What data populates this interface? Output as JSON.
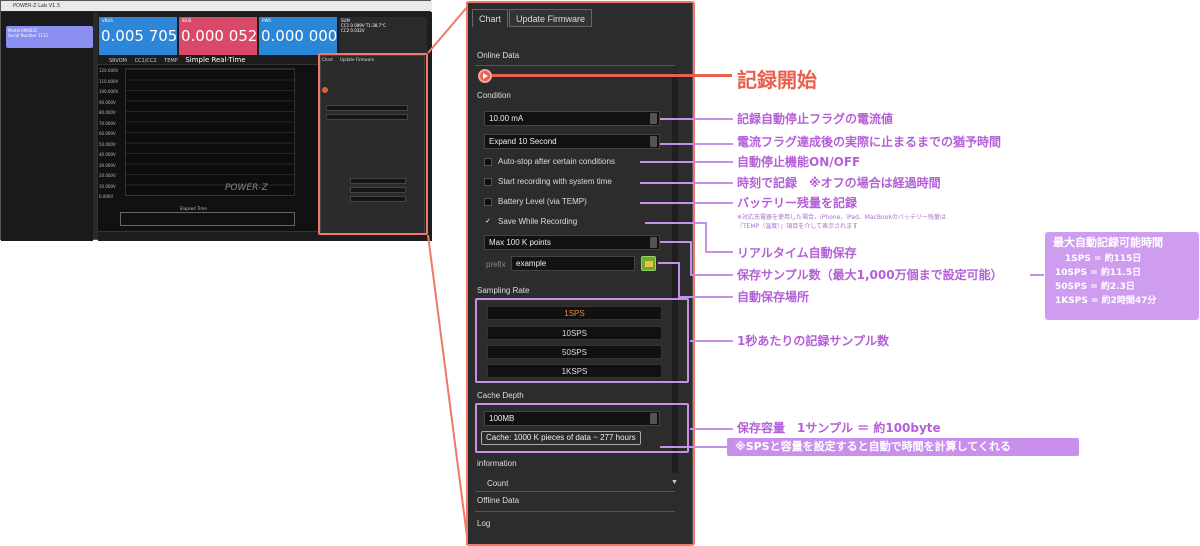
{
  "app": {
    "title": "POWER-Z Lab V1.5",
    "device": {
      "model_label": "Model",
      "model_value": "KM003C",
      "sn_label": "Serial Number",
      "sn_value": "1111"
    },
    "meters": {
      "vbus_label": "VBUS",
      "vbus_value": "0.005 705 V",
      "ibus_label": "IBUS",
      "ibus_value": "0.000 052 A",
      "pwr_label": "PWR",
      "pwr_value": "0.000 000W",
      "sum_line1": "SUM",
      "sum_line2": "CC1 0.099V  T1:38.7°C",
      "sum_line3": "CC2 0.032V"
    },
    "chart_title": "Simple Real-Time",
    "chart_tabs": [
      "SRVOM",
      "CC1/CC2",
      "TEMP"
    ],
    "y_ticks": [
      "120.000V",
      "110.000V",
      "100.000V",
      "90.000V",
      "80.000V",
      "70.000V",
      "60.000V",
      "50.000V",
      "40.000V",
      "30.000V",
      "20.000V",
      "10.000V",
      "0.000V"
    ],
    "x_label": "Elapsed Time",
    "brand": "POWER-Z"
  },
  "panel": {
    "tabs": [
      "Chart",
      "Update Firmware"
    ],
    "online_data": "Online Data",
    "condition_heading": "Condition",
    "current_value": "10.00 mA",
    "expand_value": "Expand 10 Second",
    "checks": [
      {
        "label": "Auto-stop after certain conditions",
        "checked": false
      },
      {
        "label": "Start recording with system time",
        "checked": false
      },
      {
        "label": "Battery Level (via TEMP)",
        "checked": false
      },
      {
        "label": "Save While Recording",
        "checked": true
      }
    ],
    "check_mark": "✓",
    "max_points": "Max 100 K points",
    "prefix_label": "prefix",
    "prefix_value": "example",
    "sampling_heading": "Sampling Rate",
    "rates": [
      "1SPS",
      "10SPS",
      "50SPS",
      "1KSPS"
    ],
    "cache_heading": "Cache Depth",
    "cache_value": "100MB",
    "cache_info": "Cache: 1000 K pieces of data ~ 277 hours",
    "information": "information",
    "count": "Count",
    "offline_data": "Offline Data",
    "log": "Log"
  },
  "annotations": {
    "start": "記録開始",
    "current_flag": "記録自動停止フラグの電流値",
    "grace": "電流フラグ達成後の実際に止まるまでの猶予時間",
    "autostop": "自動停止機能ON/OFF",
    "systime": "時刻で記録　※オフの場合は経過時間",
    "battery": "バッテリー残量を記録",
    "battery_note1": "※対応充電器を使用した場合、iPhone、iPad、MacBookのバッテリー残量は",
    "battery_note2": "『TEMP（温度）』項目を介して表示されます",
    "realtime_save": "リアルタイム自動保存",
    "samples": "保存サンプル数（最大1,000万個まで設定可能）",
    "location": "自動保存場所",
    "per_second": "1秒あたりの記録サンプル数",
    "capacity": "保存容量　1サンプル ＝ 約100byte",
    "calc": "※SPSと容量を設定すると自動で時間を計算してくれる"
  },
  "legend": {
    "title": "最大自動記録可能時間",
    "rows": [
      "1SPS = 約115日",
      "10SPS = 約11.5日",
      "50SPS = 約2.3日",
      "1KSPS = 約2時間47分"
    ]
  },
  "colors": {
    "accent_red": "#f07868",
    "annotation_purple": "#b55fd8"
  }
}
